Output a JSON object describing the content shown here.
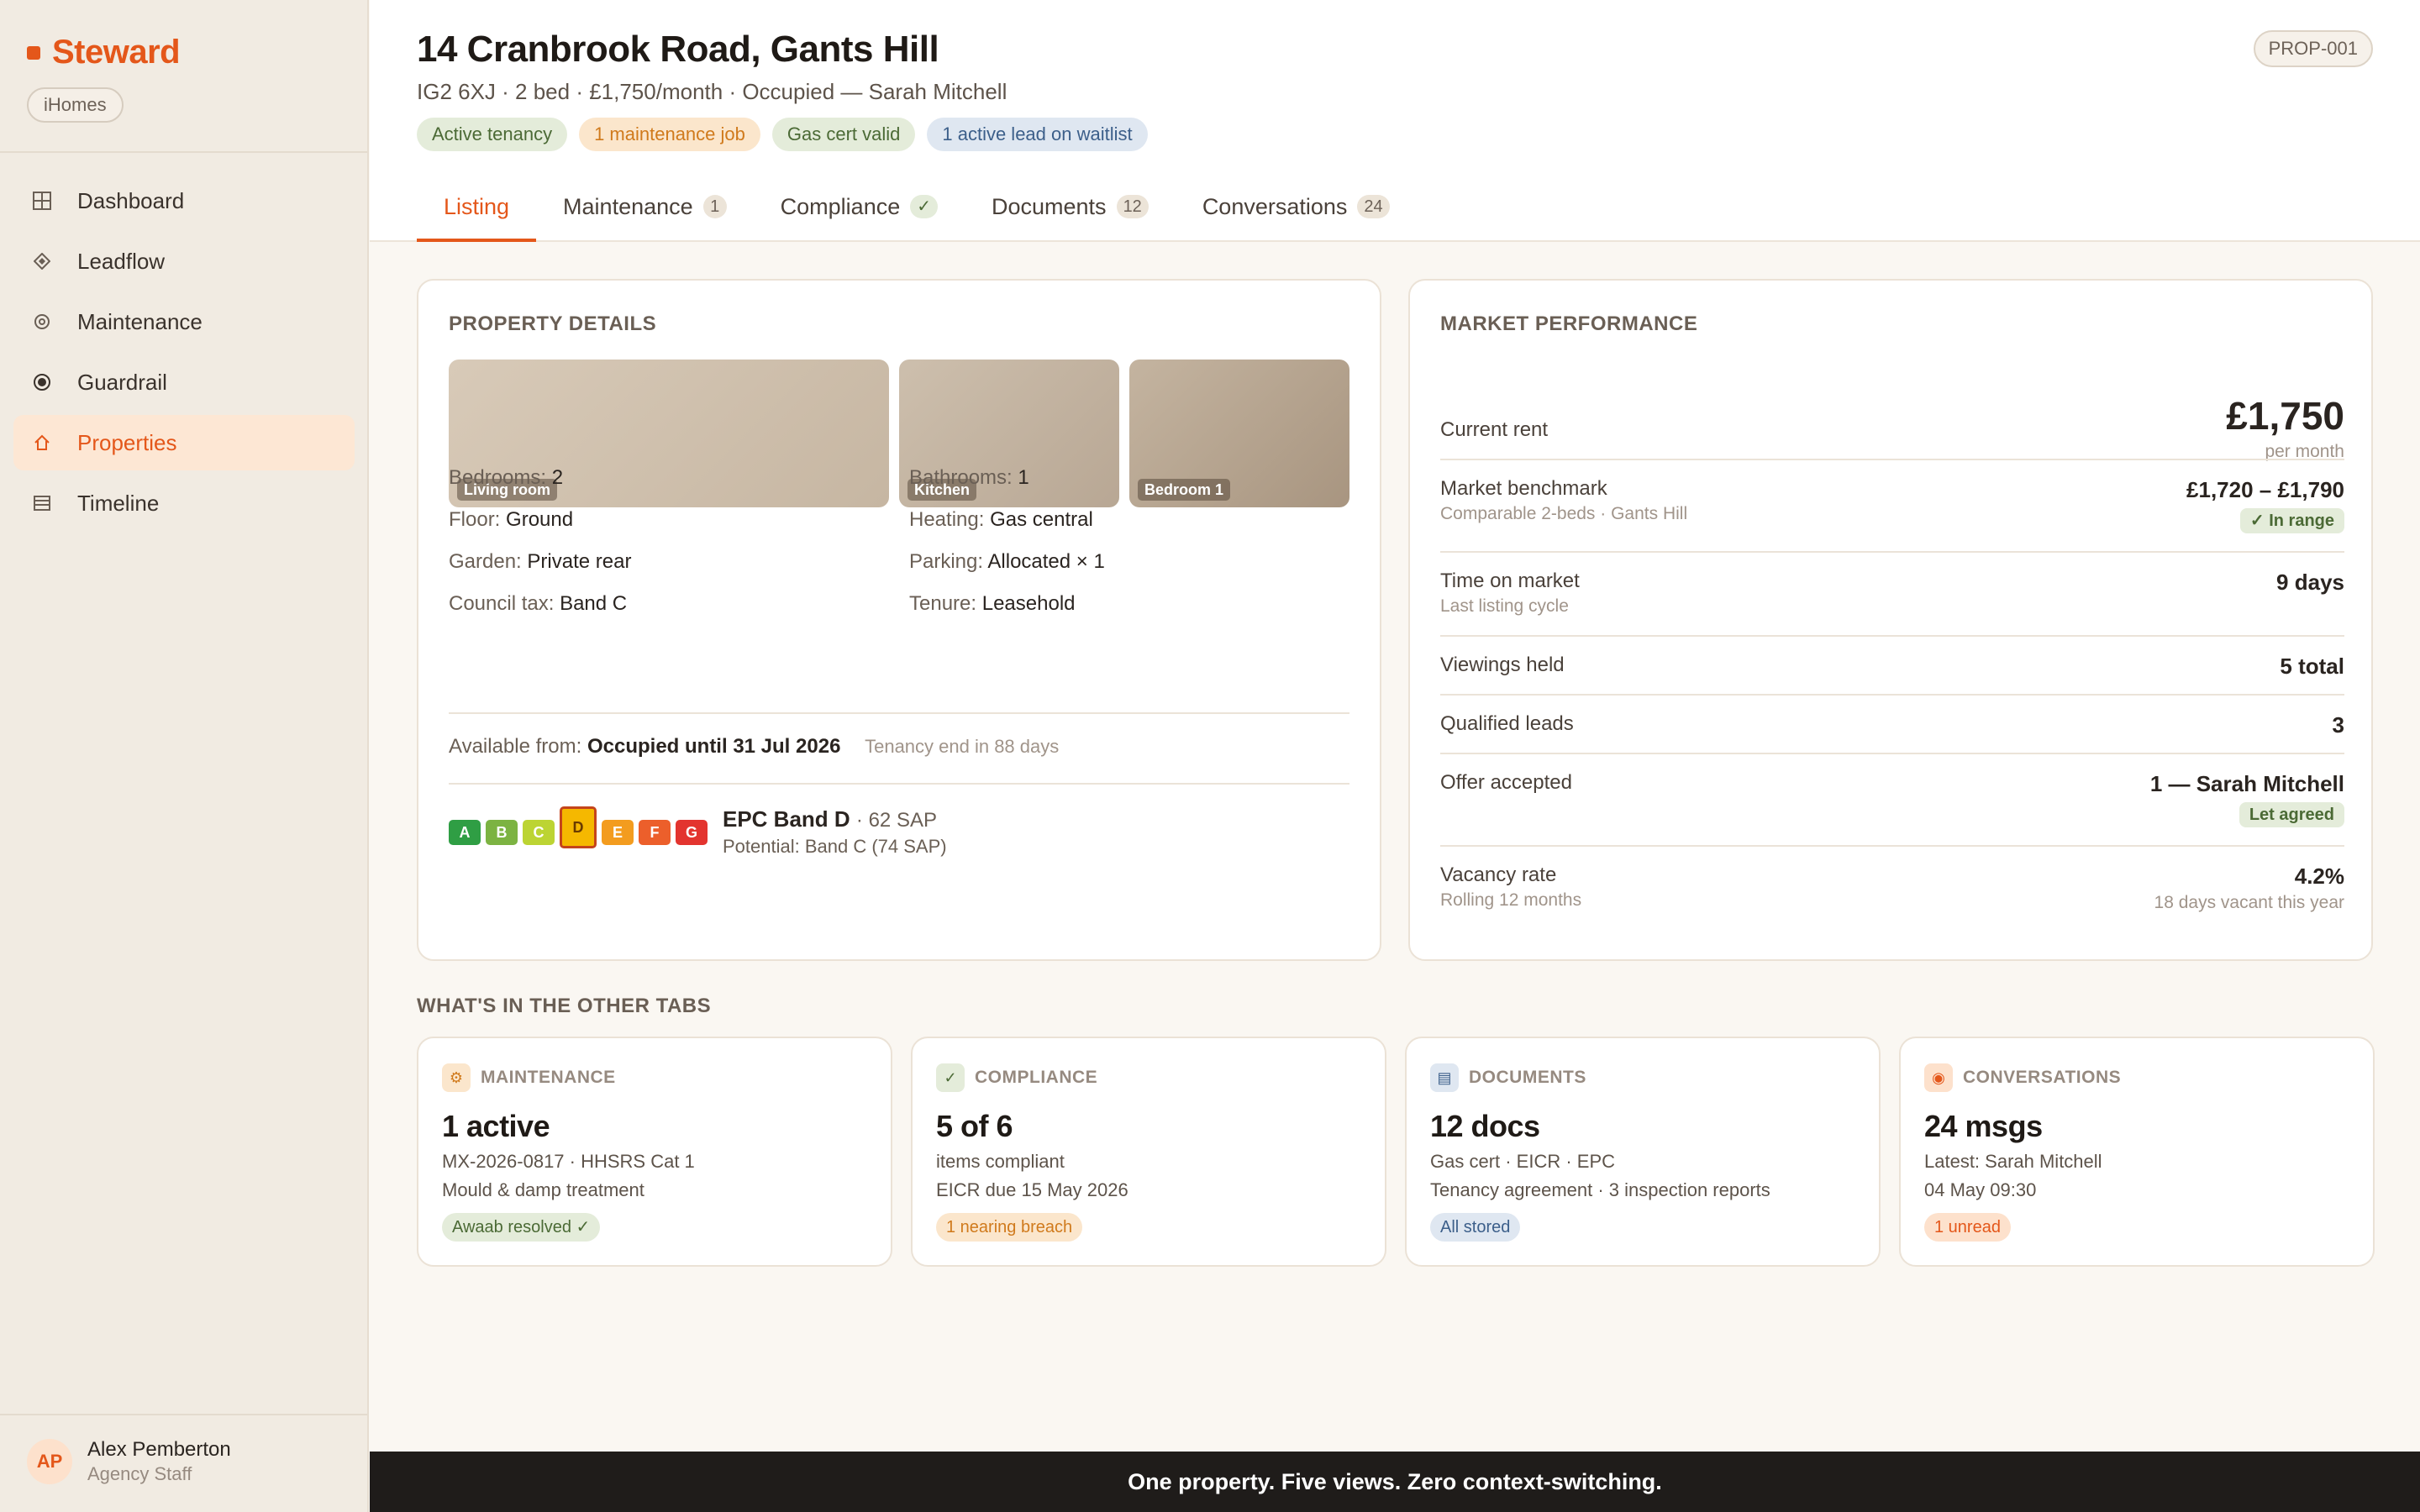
{
  "brand": {
    "name": "Steward",
    "org": "iHomes"
  },
  "sidebar": {
    "items": [
      {
        "label": "Dashboard",
        "icon": "grid-icon"
      },
      {
        "label": "Leadflow",
        "icon": "diamond-icon"
      },
      {
        "label": "Maintenance",
        "icon": "gear-icon"
      },
      {
        "label": "Guardrail",
        "icon": "target-icon"
      },
      {
        "label": "Properties",
        "icon": "home-icon"
      },
      {
        "label": "Timeline",
        "icon": "list-icon"
      }
    ],
    "active": "Properties"
  },
  "user": {
    "initials": "AP",
    "name": "Alex Pemberton",
    "role": "Agency Staff"
  },
  "header": {
    "title": "14 Cranbrook Road, Gants Hill",
    "subtitle": "IG2 6XJ · 2 bed · £1,750/month · Occupied — Sarah Mitchell",
    "property_id": "PROP-001",
    "tags": [
      {
        "label": "Active tenancy",
        "tone": "green"
      },
      {
        "label": "1 maintenance job",
        "tone": "orange"
      },
      {
        "label": "Gas cert valid",
        "tone": "green"
      },
      {
        "label": "1 active lead on waitlist",
        "tone": "blue"
      }
    ],
    "tabs": [
      {
        "label": "Listing",
        "badge": ""
      },
      {
        "label": "Maintenance",
        "badge": "1"
      },
      {
        "label": "Compliance",
        "badge": "✓"
      },
      {
        "label": "Documents",
        "badge": "12"
      },
      {
        "label": "Conversations",
        "badge": "24"
      }
    ],
    "active_tab": "Listing"
  },
  "details": {
    "title": "PROPERTY DETAILS",
    "photos": [
      "Living room",
      "Kitchen",
      "Bedroom 1"
    ],
    "facts": [
      {
        "label": "Bedrooms:",
        "value": "2"
      },
      {
        "label": "Bathrooms:",
        "value": "1"
      },
      {
        "label": "Floor:",
        "value": "Ground"
      },
      {
        "label": "Heating:",
        "value": "Gas central"
      },
      {
        "label": "Garden:",
        "value": "Private rear"
      },
      {
        "label": "Parking:",
        "value": "Allocated × 1"
      },
      {
        "label": "Council tax:",
        "value": "Band C"
      },
      {
        "label": "Tenure:",
        "value": "Leasehold"
      }
    ],
    "available_label": "Available from:",
    "available_value": "Occupied until 31 Jul 2026",
    "available_note": "Tenancy end in 88 days",
    "epc": {
      "bands": [
        "A",
        "B",
        "C",
        "D",
        "E",
        "F",
        "G"
      ],
      "colors": [
        "#2f9e44",
        "#7cb342",
        "#bcd433",
        "#f5b800",
        "#f39c1f",
        "#ec5f2b",
        "#e3342f"
      ],
      "current": "D",
      "title": "EPC Band D",
      "sap": "· 62 SAP",
      "potential": "Potential: Band C (74 SAP)"
    }
  },
  "market": {
    "title": "MARKET PERFORMANCE",
    "current_rent": {
      "label": "Current rent",
      "value": "£1,750",
      "sub": "per month"
    },
    "benchmark": {
      "label": "Market benchmark",
      "sub": "Comparable 2-beds · Gants Hill",
      "value": "£1,720 – £1,790",
      "chip": "✓ In range"
    },
    "time_on_market": {
      "label": "Time on market",
      "sub": "Last listing cycle",
      "value": "9 days"
    },
    "viewings": {
      "label": "Viewings held",
      "value": "5 total"
    },
    "leads": {
      "label": "Qualified leads",
      "value": "3"
    },
    "offer": {
      "label": "Offer accepted",
      "value": "1 — Sarah Mitchell",
      "chip": "Let agreed"
    },
    "vacancy": {
      "label": "Vacancy rate",
      "sub": "Rolling 12 months",
      "value": "4.2%",
      "vsub": "18 days vacant this year"
    }
  },
  "other_tabs": {
    "title": "WHAT'S IN THE OTHER TABS",
    "cards": [
      {
        "label": "MAINTENANCE",
        "icon": "gear-icon",
        "big": "1 active",
        "line1": "MX-2026-0817 · HHSRS Cat 1",
        "line2": "Mould & damp treatment",
        "chip": "Awaab resolved ✓",
        "tone": "green"
      },
      {
        "label": "COMPLIANCE",
        "icon": "check-icon",
        "big": "5 of 6",
        "line1": "items compliant",
        "line2": "EICR due 15 May 2026",
        "chip": "1 nearing breach",
        "tone": "orange"
      },
      {
        "label": "DOCUMENTS",
        "icon": "document-icon",
        "big": "12 docs",
        "line1": "Gas cert · EICR · EPC",
        "line2": "Tenancy agreement · 3 inspection reports",
        "chip": "All stored",
        "tone": "blue"
      },
      {
        "label": "CONVERSATIONS",
        "icon": "chat-icon",
        "big": "24 msgs",
        "line1": "Latest: Sarah Mitchell",
        "line2": "04 May 09:30",
        "chip": "1 unread",
        "tone": "orange"
      }
    ]
  },
  "footer": {
    "text": "One property. Five views. Zero context-switching."
  },
  "colors": {
    "accent": "#e4571a",
    "sidebar_bg": "#f1ebe2",
    "page_bg": "#faf7f2"
  }
}
